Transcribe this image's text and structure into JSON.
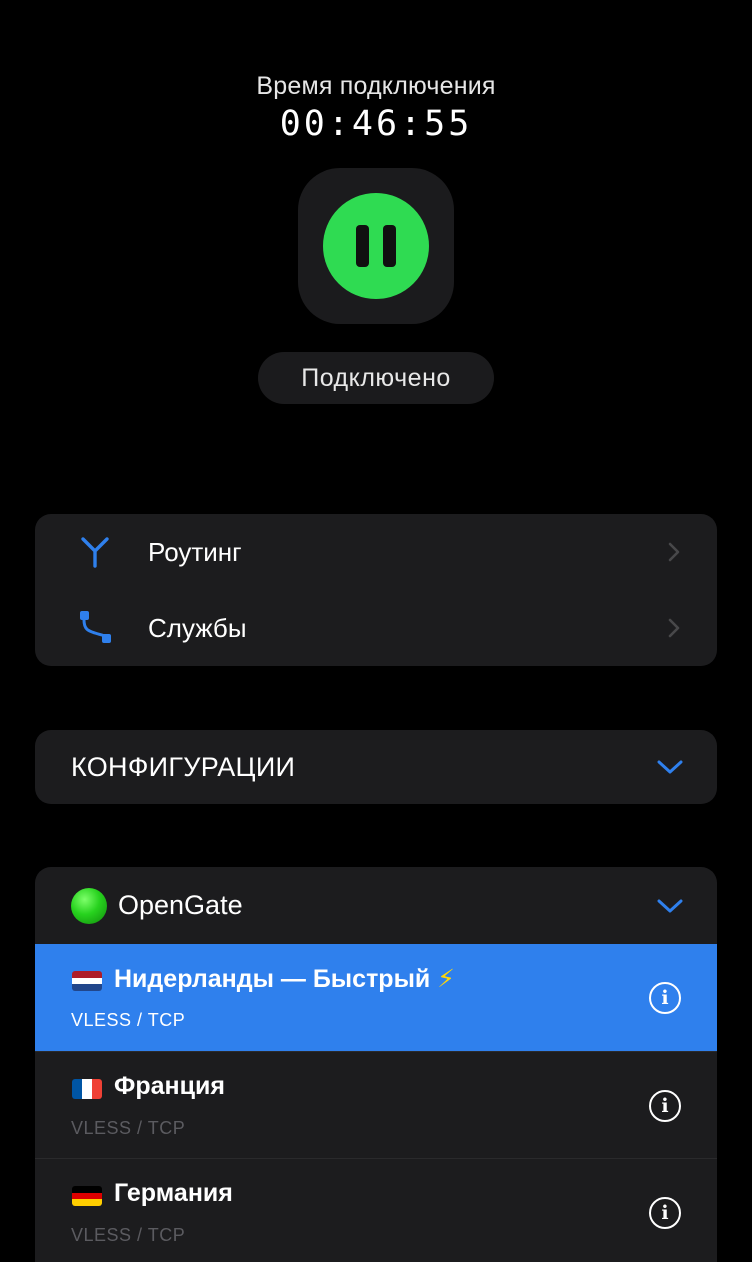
{
  "connection": {
    "timer_label": "Время подключения",
    "timer_value": "00:46:55",
    "status": "Подключено",
    "state_color": "#2fdb52"
  },
  "menu": {
    "items": [
      {
        "label": "Роутинг",
        "icon": "routing-icon"
      },
      {
        "label": "Службы",
        "icon": "services-icon"
      }
    ]
  },
  "configs": {
    "title": "КОНФИГУРАЦИИ"
  },
  "group": {
    "name": "OpenGate",
    "servers": [
      {
        "name": "Нидерланды — Быстрый",
        "badge": "⚡",
        "protocol": "VLESS / TCP",
        "flag": "netherlands-flag",
        "selected": true
      },
      {
        "name": "Франция",
        "protocol": "VLESS / TCP",
        "flag": "france-flag",
        "selected": false
      },
      {
        "name": "Германия",
        "protocol": "VLESS / TCP",
        "flag": "germany-flag",
        "selected": false
      }
    ]
  },
  "colors": {
    "accent": "#2f80ed",
    "card": "#1c1c1e",
    "connected": "#2fdb52"
  }
}
